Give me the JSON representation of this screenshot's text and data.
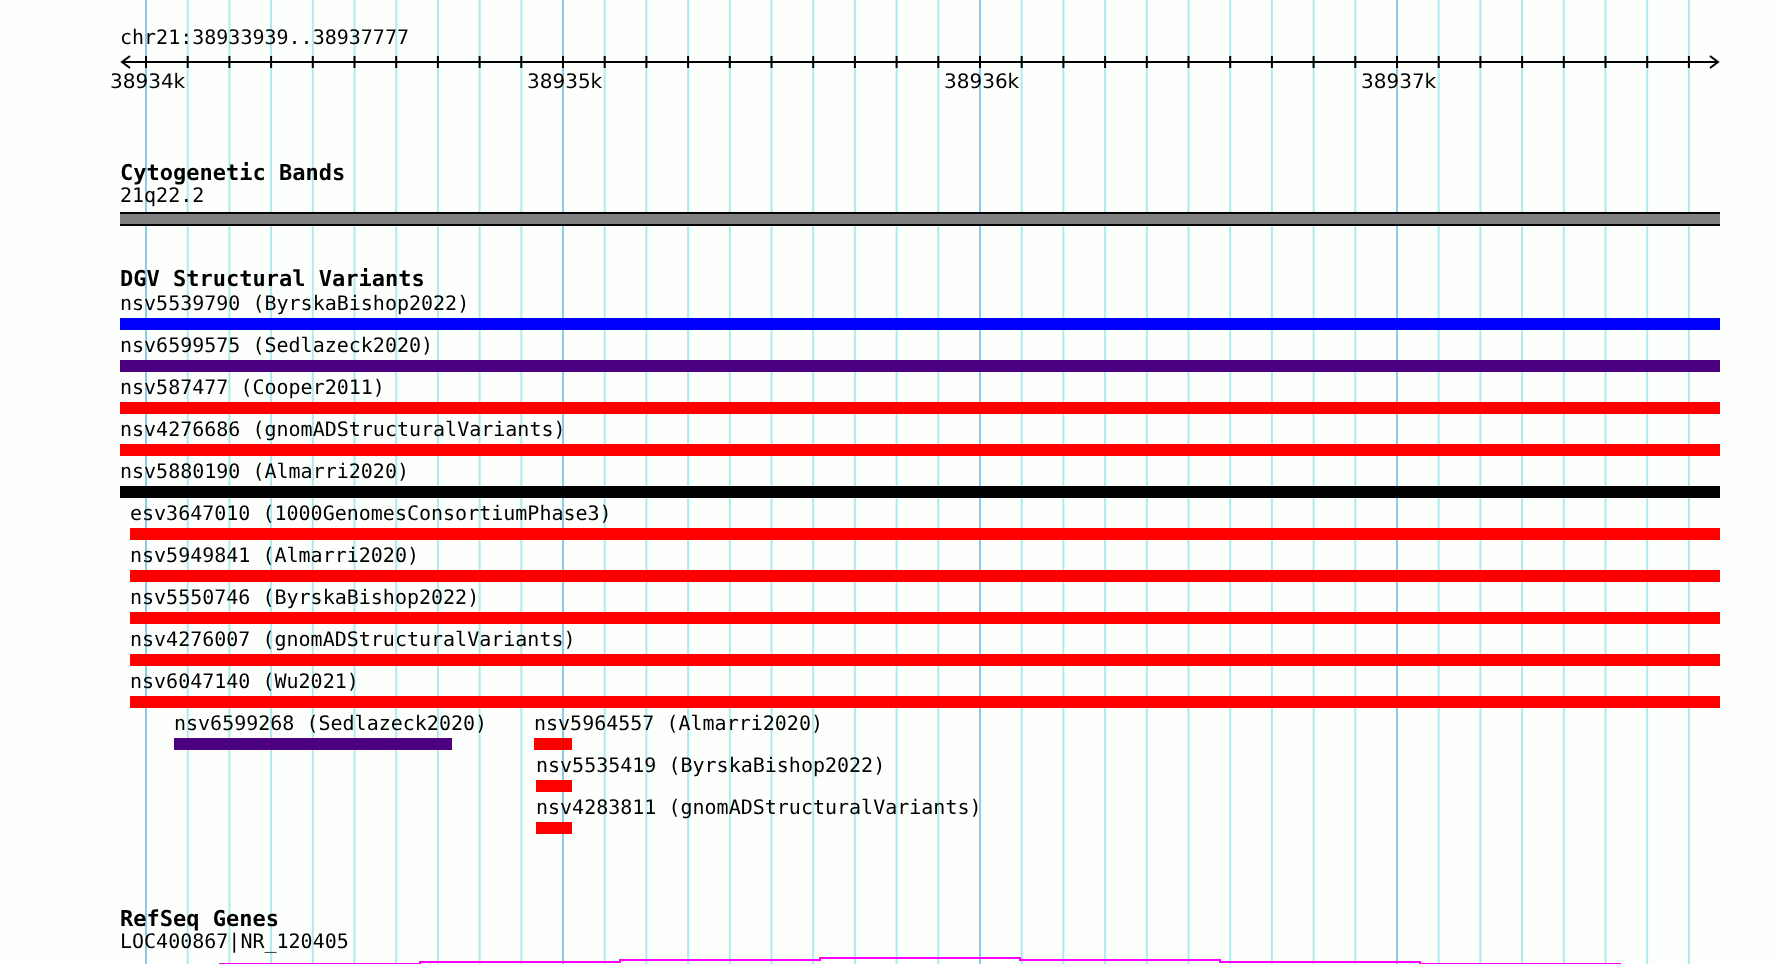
{
  "ruler": {
    "location": "chr21:38933939..38937777",
    "tick_labels": [
      "38934k",
      "38935k",
      "38936k",
      "38937k"
    ]
  },
  "cytogenetic_bands": {
    "title": "Cytogenetic Bands",
    "band": "21q22.2"
  },
  "dgv_structural_variants": {
    "title": "DGV Structural Variants",
    "features": [
      {
        "label": "nsv5539790 (ByrskaBishop2022)",
        "color": "#0000ff"
      },
      {
        "label": "nsv6599575 (Sedlazeck2020)",
        "color": "#4b0082"
      },
      {
        "label": "nsv587477 (Cooper2011)",
        "color": "#ff0000"
      },
      {
        "label": "nsv4276686 (gnomADStructuralVariants)",
        "color": "#ff0000"
      },
      {
        "label": "nsv5880190 (Almarri2020)",
        "color": "#000000"
      },
      {
        "label": "esv3647010 (1000GenomesConsortiumPhase3)",
        "color": "#ff0000"
      },
      {
        "label": "nsv5949841 (Almarri2020)",
        "color": "#ff0000"
      },
      {
        "label": "nsv5550746 (ByrskaBishop2022)",
        "color": "#ff0000"
      },
      {
        "label": "nsv4276007 (gnomADStructuralVariants)",
        "color": "#ff0000"
      },
      {
        "label": "nsv6047140 (Wu2021)",
        "color": "#ff0000"
      },
      {
        "label": "nsv6599268 (Sedlazeck2020)",
        "color": "#4b0082"
      },
      {
        "label": "nsv5964557 (Almarri2020)",
        "color": "#ff0000"
      },
      {
        "label": "nsv5535419 (ByrskaBishop2022)",
        "color": "#ff0000"
      },
      {
        "label": "nsv4283811 (gnomADStructuralVariants)",
        "color": "#ff0000"
      }
    ]
  },
  "refseq_genes": {
    "title": "RefSeq Genes",
    "gene": "LOC400867|NR_120405"
  }
}
